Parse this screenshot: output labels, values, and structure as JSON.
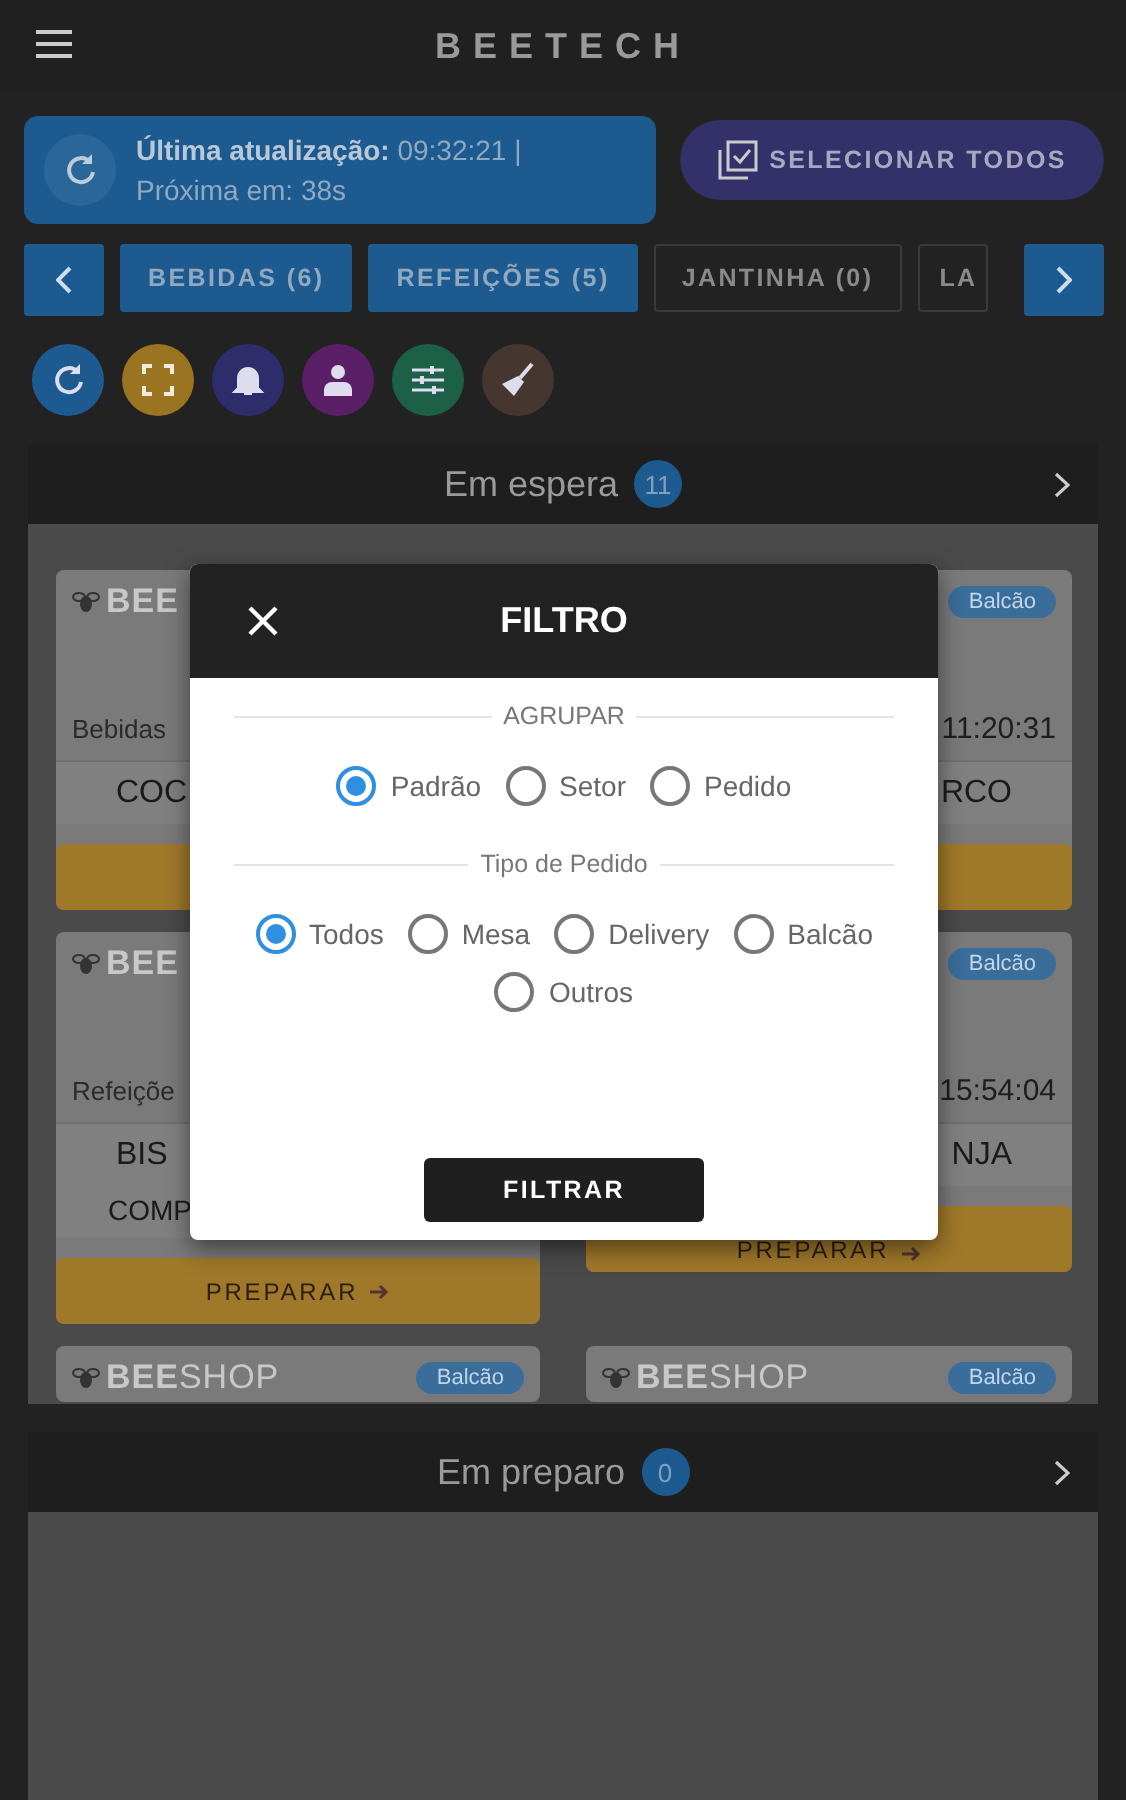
{
  "header": {
    "title": "BEETECH"
  },
  "update_info": {
    "last": "**Última atualização:** 09:32:21 |",
    "next": "Próxima em: 38s"
  },
  "select_all_button": {
    "label": "SELECIONAR TODOS"
  },
  "category_tabs": [
    {
      "label": "BEBIDAS (6)",
      "selected": true
    },
    {
      "label": "REFEIÇÕES (5)",
      "selected": true
    },
    {
      "label": "JANTINHA (0)",
      "selected": false
    },
    {
      "label": "LA",
      "selected": false
    }
  ],
  "action_buttons": [
    {
      "kind": "refresh",
      "color": "#1d5a90"
    },
    {
      "kind": "expand",
      "color": "#9a7420"
    },
    {
      "kind": "bell",
      "color": "#2e2c6a"
    },
    {
      "kind": "person",
      "color": "#5a1f66"
    },
    {
      "kind": "sliders",
      "color": "#1c6048"
    },
    {
      "kind": "broom",
      "color": "#453730"
    }
  ],
  "sections": [
    {
      "title": "Em espera",
      "count": "11",
      "cards": [
        {
          "logo": "**BEE**",
          "category": "Bebidas",
          "name": "COC",
          "has_button": true
        },
        {
          "badge": "Balcão",
          "time": "11:20:31",
          "name": "RCO",
          "has_button": true
        },
        {
          "logo": "**BEE**",
          "category": "Refeiçõe",
          "name": "BIS",
          "detail": "COMP",
          "button": "PREPARAR"
        },
        {
          "badge": "Balcão",
          "time": "15:54:04",
          "name": "NJA",
          "button": "PREPARAR"
        },
        {
          "logo": "**BEE**SHOP",
          "badge": "Balcão"
        },
        {
          "logo": "**BEE**SHOP",
          "badge": "Balcão"
        }
      ]
    },
    {
      "title": "Em preparo",
      "count": "0"
    }
  ],
  "dialog": {
    "title": "FILTRO",
    "groups": [
      {
        "label": "AGRUPAR",
        "options": [
          {
            "label": "Padrão",
            "selected": true
          },
          {
            "label": "Setor",
            "selected": false
          },
          {
            "label": "Pedido",
            "selected": false
          }
        ]
      },
      {
        "label": "Tipo de Pedido",
        "options": [
          {
            "label": "Todos",
            "selected": true
          },
          {
            "label": "Mesa",
            "selected": false
          },
          {
            "label": "Delivery",
            "selected": false
          },
          {
            "label": "Balcão",
            "selected": false
          },
          {
            "label": "Outros",
            "selected": false
          }
        ]
      }
    ],
    "button": "FILTRAR"
  }
}
